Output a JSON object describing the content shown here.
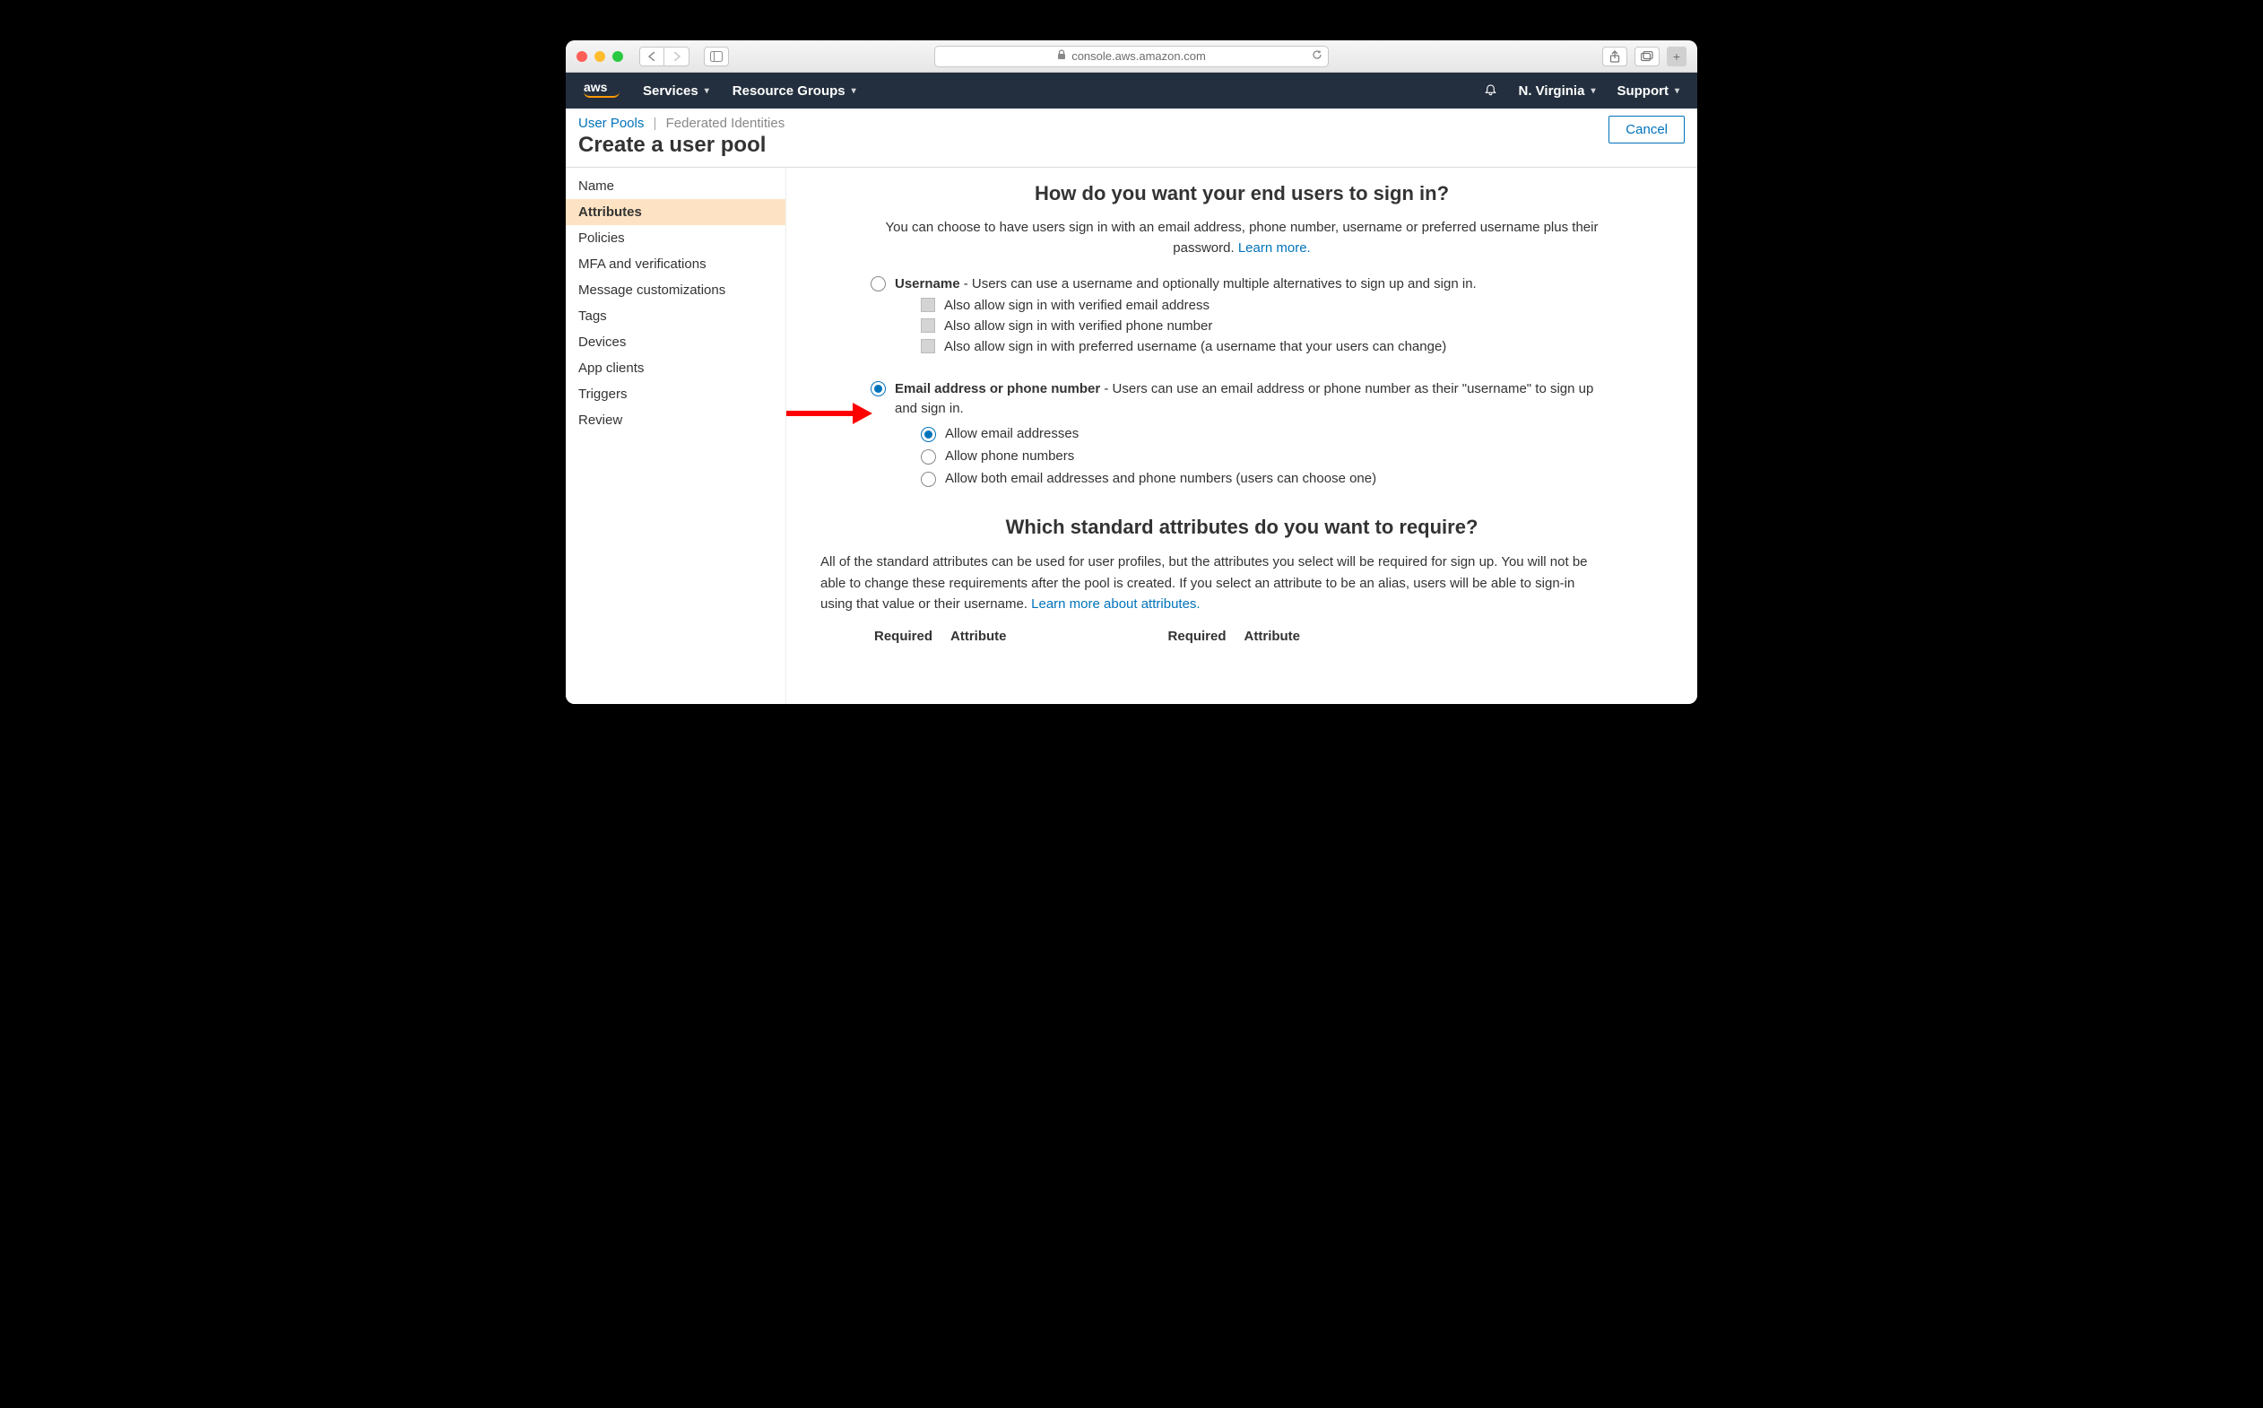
{
  "browser": {
    "url": "console.aws.amazon.com"
  },
  "aws_nav": {
    "services": "Services",
    "resource_groups": "Resource Groups",
    "region": "N. Virginia",
    "support": "Support"
  },
  "crumbs": {
    "user_pools": "User Pools",
    "federated": "Federated Identities"
  },
  "page_title": "Create a user pool",
  "cancel": "Cancel",
  "sidebar": {
    "items": [
      {
        "label": "Name"
      },
      {
        "label": "Attributes"
      },
      {
        "label": "Policies"
      },
      {
        "label": "MFA and verifications"
      },
      {
        "label": "Message customizations"
      },
      {
        "label": "Tags"
      },
      {
        "label": "Devices"
      },
      {
        "label": "App clients"
      },
      {
        "label": "Triggers"
      },
      {
        "label": "Review"
      }
    ],
    "active_index": 1
  },
  "signin": {
    "heading": "How do you want your end users to sign in?",
    "lead": "You can choose to have users sign in with an email address, phone number, username or preferred username plus their password. ",
    "learn_more": "Learn more.",
    "opt_username_bold": "Username",
    "opt_username_rest": " - Users can use a username and optionally multiple alternatives to sign up and sign in.",
    "chk_email": "Also allow sign in with verified email address",
    "chk_phone": "Also allow sign in with verified phone number",
    "chk_preferred": "Also allow sign in with preferred username (a username that your users can change)",
    "opt_email_bold": "Email address or phone number",
    "opt_email_rest": " - Users can use an email address or phone number as their \"username\" to sign up and sign in.",
    "sub_email": "Allow email addresses",
    "sub_phone": "Allow phone numbers",
    "sub_both": "Allow both email addresses and phone numbers (users can choose one)"
  },
  "attrs": {
    "heading": "Which standard attributes do you want to require?",
    "lead": "All of the standard attributes can be used for user profiles, but the attributes you select will be required for sign up. You will not be able to change these requirements after the pool is created. If you select an attribute to be an alias, users will be able to sign-in using that value or their username. ",
    "learn_more": "Learn more about attributes.",
    "col_required": "Required",
    "col_attribute": "Attribute"
  }
}
